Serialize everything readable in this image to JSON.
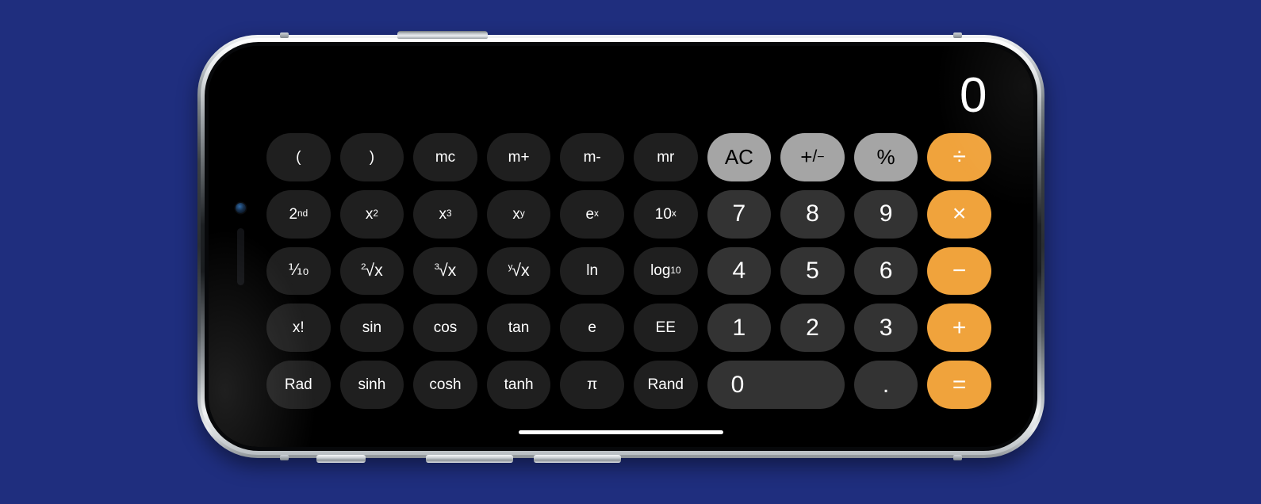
{
  "background_color": "#1f2e7e",
  "device": {
    "name": "iphone-landscape",
    "frame_color": "#c9ced2",
    "hardware": {
      "power_button": "power-button",
      "mute_switch": "mute-switch",
      "volume_up": "volume-up-button",
      "volume_down": "volume-down-button",
      "front_camera": "front-camera",
      "earpiece_speaker": "earpiece-speaker"
    }
  },
  "app": {
    "name": "Calculator",
    "mode": "scientific",
    "display_value": "0",
    "colors": {
      "screen": "#000000",
      "scientific_key": "#1f1f1f",
      "number_key": "#333333",
      "function_key": "#a5a5a5",
      "operator_key": "#f0a33c",
      "key_text": "#ffffff",
      "function_key_text": "#000000",
      "home_indicator": "#ffffff"
    },
    "keys": [
      [
        {
          "label": "(",
          "name": "key-open-paren",
          "style": "sci"
        },
        {
          "label": ")",
          "name": "key-close-paren",
          "style": "sci"
        },
        {
          "label": "mc",
          "name": "key-memory-clear",
          "style": "sci"
        },
        {
          "label": "m+",
          "name": "key-memory-add",
          "style": "sci"
        },
        {
          "label": "m-",
          "name": "key-memory-subtract",
          "style": "sci"
        },
        {
          "label": "mr",
          "name": "key-memory-recall",
          "style": "sci"
        },
        {
          "label": "AC",
          "name": "key-all-clear",
          "style": "fn"
        },
        {
          "label": "+/-",
          "name": "key-sign-toggle",
          "style": "fn"
        },
        {
          "label": "%",
          "name": "key-percent",
          "style": "fn"
        },
        {
          "label": "÷",
          "name": "key-divide",
          "style": "op"
        }
      ],
      [
        {
          "label": "2nd",
          "name": "key-second",
          "style": "sci"
        },
        {
          "label": "x²",
          "name": "key-x-squared",
          "style": "sci"
        },
        {
          "label": "x³",
          "name": "key-x-cubed",
          "style": "sci"
        },
        {
          "label": "xʸ",
          "name": "key-x-to-y",
          "style": "sci"
        },
        {
          "label": "eˣ",
          "name": "key-e-to-x",
          "style": "sci"
        },
        {
          "label": "10ˣ",
          "name": "key-ten-to-x",
          "style": "sci"
        },
        {
          "label": "7",
          "name": "key-7",
          "style": "num"
        },
        {
          "label": "8",
          "name": "key-8",
          "style": "num"
        },
        {
          "label": "9",
          "name": "key-9",
          "style": "num"
        },
        {
          "label": "×",
          "name": "key-multiply",
          "style": "op"
        }
      ],
      [
        {
          "label": "⅒",
          "name": "key-reciprocal",
          "style": "sci"
        },
        {
          "label": "²√x",
          "name": "key-square-root",
          "style": "sci"
        },
        {
          "label": "³√x",
          "name": "key-cube-root",
          "style": "sci"
        },
        {
          "label": "ʸ√x",
          "name": "key-y-root",
          "style": "sci"
        },
        {
          "label": "ln",
          "name": "key-natural-log",
          "style": "sci"
        },
        {
          "label": "log₁₀",
          "name": "key-log-base-10",
          "style": "sci"
        },
        {
          "label": "4",
          "name": "key-4",
          "style": "num"
        },
        {
          "label": "5",
          "name": "key-5",
          "style": "num"
        },
        {
          "label": "6",
          "name": "key-6",
          "style": "num"
        },
        {
          "label": "−",
          "name": "key-subtract",
          "style": "op"
        }
      ],
      [
        {
          "label": "x!",
          "name": "key-factorial",
          "style": "sci"
        },
        {
          "label": "sin",
          "name": "key-sin",
          "style": "sci"
        },
        {
          "label": "cos",
          "name": "key-cos",
          "style": "sci"
        },
        {
          "label": "tan",
          "name": "key-tan",
          "style": "sci"
        },
        {
          "label": "e",
          "name": "key-euler",
          "style": "sci"
        },
        {
          "label": "EE",
          "name": "key-exponent",
          "style": "sci"
        },
        {
          "label": "1",
          "name": "key-1",
          "style": "num"
        },
        {
          "label": "2",
          "name": "key-2",
          "style": "num"
        },
        {
          "label": "3",
          "name": "key-3",
          "style": "num"
        },
        {
          "label": "+",
          "name": "key-add",
          "style": "op"
        }
      ],
      [
        {
          "label": "Rad",
          "name": "key-radians",
          "style": "sci"
        },
        {
          "label": "sinh",
          "name": "key-sinh",
          "style": "sci"
        },
        {
          "label": "cosh",
          "name": "key-cosh",
          "style": "sci"
        },
        {
          "label": "tanh",
          "name": "key-tanh",
          "style": "sci"
        },
        {
          "label": "π",
          "name": "key-pi",
          "style": "sci"
        },
        {
          "label": "Rand",
          "name": "key-random",
          "style": "sci"
        },
        {
          "label": "0",
          "name": "key-0",
          "style": "num zero"
        },
        {
          "label": ".",
          "name": "key-decimal",
          "style": "num"
        },
        {
          "label": "=",
          "name": "key-equals",
          "style": "op"
        }
      ]
    ]
  }
}
